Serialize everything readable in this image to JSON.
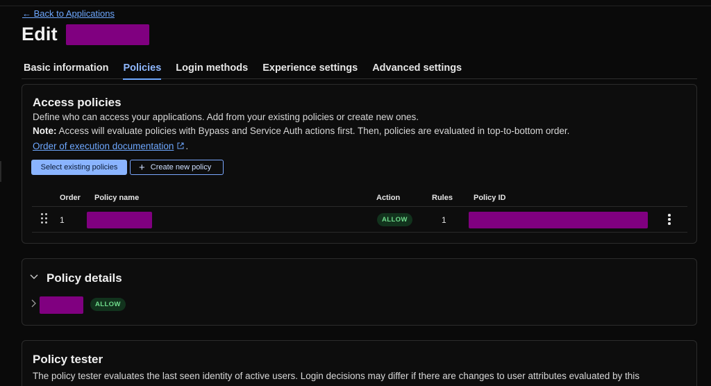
{
  "nav": {
    "back_label": "← Back to Applications"
  },
  "page": {
    "title": "Edit"
  },
  "tabs": [
    {
      "label": "Basic information"
    },
    {
      "label": "Policies"
    },
    {
      "label": "Login methods"
    },
    {
      "label": "Experience settings"
    },
    {
      "label": "Advanced settings"
    }
  ],
  "access_policies": {
    "title": "Access policies",
    "description": "Define who can access your applications. Add from your existing policies or create new ones.",
    "note_label": "Note:",
    "note_text": " Access will evaluate policies with Bypass and Service Auth actions first. Then, policies are evaluated in top-to-bottom order.",
    "doc_link": "Order of execution documentation",
    "doc_link_suffix": ".",
    "select_button": "Select existing policies",
    "create_button": "Create new policy",
    "columns": {
      "order": "Order",
      "name": "Policy name",
      "action": "Action",
      "rules": "Rules",
      "id": "Policy ID"
    },
    "rows": [
      {
        "order": "1",
        "action": "ALLOW",
        "rules": "1"
      }
    ]
  },
  "policy_details": {
    "title": "Policy details",
    "items": [
      {
        "action": "ALLOW"
      }
    ]
  },
  "policy_tester": {
    "title": "Policy tester",
    "description": "The policy tester evaluates the last seen identity of active users. Login decisions may differ if there are changes to user attributes evaluated by this"
  },
  "colors": {
    "accent": "#6ea8ff",
    "redaction": "#800080",
    "allow_text": "#6fdc8c",
    "allow_bg": "#12331d"
  },
  "icons": [
    "external-link-icon",
    "plus-icon",
    "drag-handle-icon",
    "kebab-menu-icon",
    "chevron-down-icon",
    "chevron-right-icon"
  ]
}
